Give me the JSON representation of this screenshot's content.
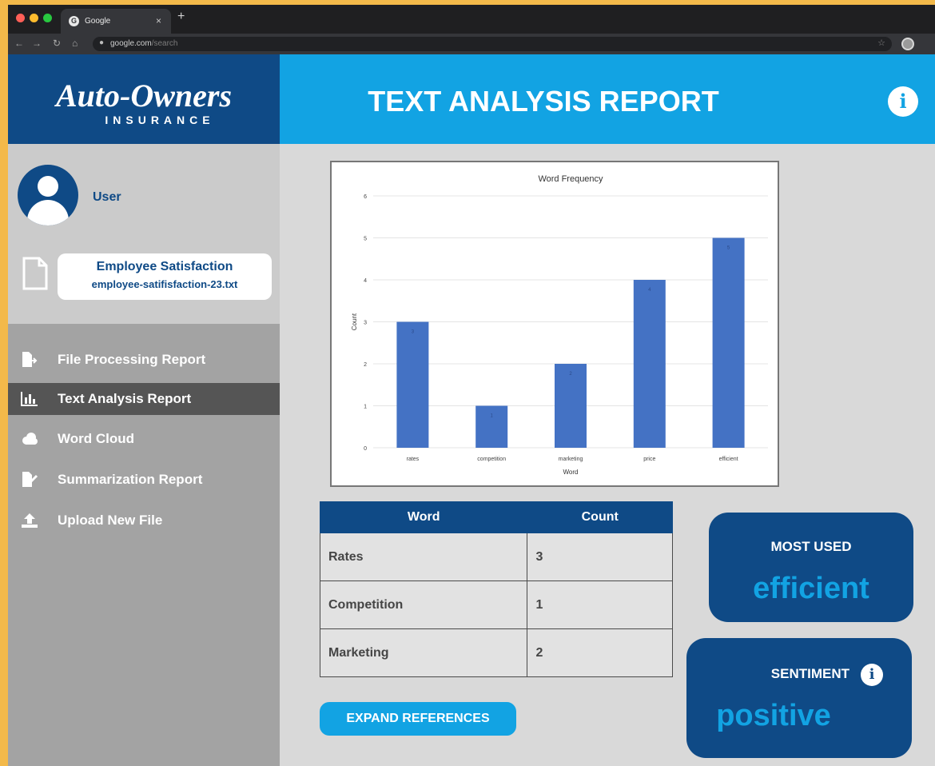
{
  "browser": {
    "tab_title": "Google",
    "tab_close": "×",
    "new_tab": "+",
    "favicon": "G",
    "url_host": "google.com",
    "url_path": "/search"
  },
  "brand": {
    "logo_main": "Auto-Owners",
    "logo_sub": "INSURANCE"
  },
  "header": {
    "title": "TEXT ANALYSIS REPORT",
    "info_icon": "i"
  },
  "user": {
    "name": "User"
  },
  "file": {
    "title": "Employee Satisfaction",
    "name": "employee-satifisfaction-23.txt"
  },
  "nav": {
    "items": [
      {
        "label": "File Processing Report",
        "icon": "file-export-icon",
        "active": false
      },
      {
        "label": "Text Analysis Report",
        "icon": "bar-chart-icon",
        "active": true
      },
      {
        "label": "Word Cloud",
        "icon": "cloud-icon",
        "active": false
      },
      {
        "label": "Summarization Report",
        "icon": "file-signature-icon",
        "active": false
      },
      {
        "label": "Upload New File",
        "icon": "upload-icon",
        "active": false
      }
    ]
  },
  "table": {
    "headers": [
      "Word",
      "Count"
    ],
    "rows": [
      [
        "Rates",
        "3"
      ],
      [
        "Competition",
        "1"
      ],
      [
        "Marketing",
        "2"
      ]
    ]
  },
  "buttons": {
    "expand": "EXPAND REFERENCES"
  },
  "most_used": {
    "label": "MOST USED",
    "value": "efficient"
  },
  "sentiment": {
    "label": "SENTIMENT",
    "value": "positive",
    "info_icon": "i"
  },
  "colors": {
    "brand_dark": "#0f4a86",
    "brand_light": "#12a3e3",
    "bar": "#4472c4"
  },
  "chart_data": {
    "type": "bar",
    "title": "Word Frequency",
    "xlabel": "Word",
    "ylabel": "Count",
    "categories": [
      "rates",
      "competition",
      "marketing",
      "price",
      "efficient"
    ],
    "values": [
      3,
      1,
      2,
      4,
      5
    ],
    "ylim": [
      0,
      6
    ],
    "yticks": [
      0,
      1,
      2,
      3,
      4,
      5,
      6
    ],
    "grid": true,
    "legend": "none"
  }
}
